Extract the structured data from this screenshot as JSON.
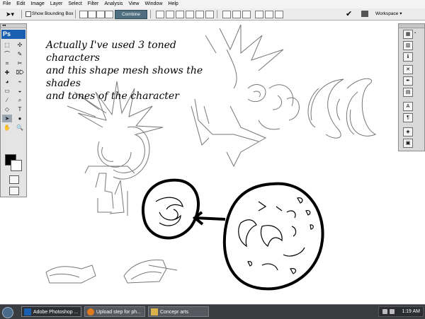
{
  "menu": [
    "File",
    "Edit",
    "Image",
    "Layer",
    "Select",
    "Filter",
    "Analysis",
    "View",
    "Window",
    "Help"
  ],
  "options": {
    "show_bounding_box": "Show Bounding Box",
    "combine": "Combine",
    "workspace": "Workspace ▾"
  },
  "tools": {
    "ps_logo": "Ps",
    "icons": [
      "⬚",
      "✣",
      "⌒",
      "✎",
      "⌗",
      "✂",
      "✚",
      "⌦",
      "◕",
      "⌁",
      "▭",
      "◒",
      "∕",
      "⌕",
      "◇",
      "T",
      "➤",
      "●",
      "✋",
      "🔍"
    ]
  },
  "annotation": {
    "line1": "Actually I've used 3 toned characters",
    "line2": "and this shape mesh shows the shades",
    "line3": "and tones of the character"
  },
  "taskbar": {
    "items": [
      "Adobe Photoshop ...",
      "Upload step for ph...",
      "Concepr arts"
    ],
    "clock": "1:19 AM"
  }
}
